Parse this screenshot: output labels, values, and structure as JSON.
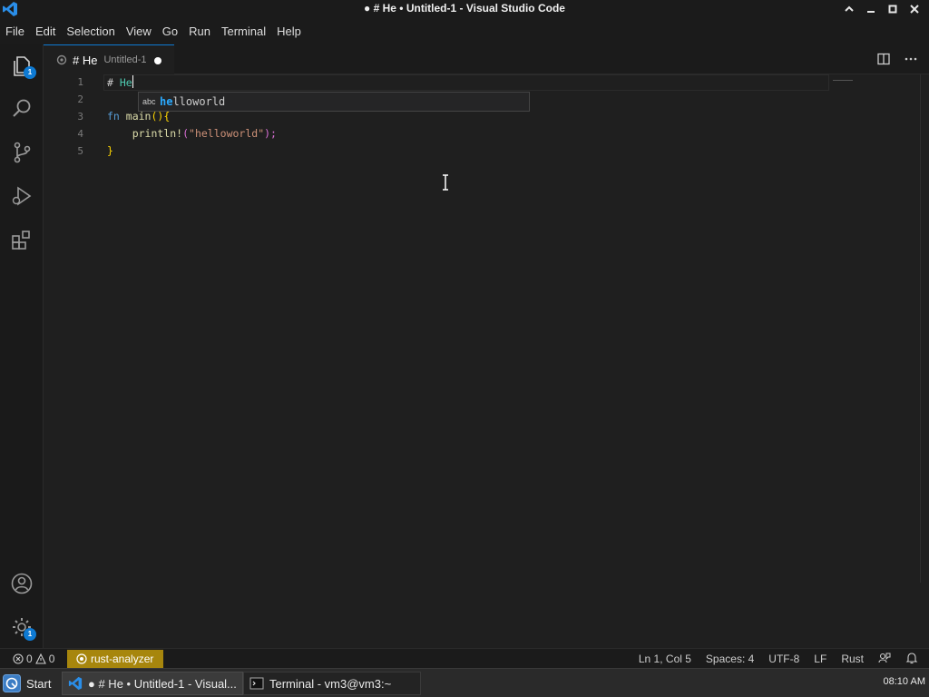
{
  "window": {
    "title": "● # He • Untitled-1 - Visual Studio Code"
  },
  "menu": {
    "items": [
      "File",
      "Edit",
      "Selection",
      "View",
      "Go",
      "Run",
      "Terminal",
      "Help"
    ]
  },
  "activity": {
    "explorer_badge": "1",
    "settings_badge": "1"
  },
  "tab": {
    "name": "# He",
    "description": "Untitled-1"
  },
  "editor": {
    "lines": [
      {
        "number": "1",
        "text": "# He"
      },
      {
        "number": "2",
        "text": ""
      },
      {
        "number": "3",
        "text": "fn main(){"
      },
      {
        "number": "4",
        "text": "    println!(\"helloworld\");"
      },
      {
        "number": "5",
        "text": "}"
      }
    ],
    "tokens": {
      "l1_hash": "# ",
      "l1_word": "He",
      "l3_fn": "fn ",
      "l3_name": "main",
      "l3_paren": "()",
      "l3_brace": "{",
      "l4_indent": "    ",
      "l4_macro": "println!",
      "l4_open": "(",
      "l4_str": "\"helloworld\"",
      "l4_close": ");",
      "l5_brace": "}"
    }
  },
  "suggest": {
    "kind": "abc",
    "match": "he",
    "rest": "lloworld"
  },
  "status": {
    "errors": "0",
    "warnings": "0",
    "extension": "rust-analyzer",
    "position": "Ln 1, Col 5",
    "spaces": "Spaces: 4",
    "encoding": "UTF-8",
    "eol": "LF",
    "language": "Rust"
  },
  "taskbar": {
    "start_label": "Start",
    "vscode_task": "● # He • Untitled-1 - Visual...",
    "terminal_task": "Terminal - vm3@vm3:~",
    "clock": "08:10 AM"
  },
  "colors": {
    "accent": "#0e7ad3",
    "rust_badge": "#a7860d"
  }
}
